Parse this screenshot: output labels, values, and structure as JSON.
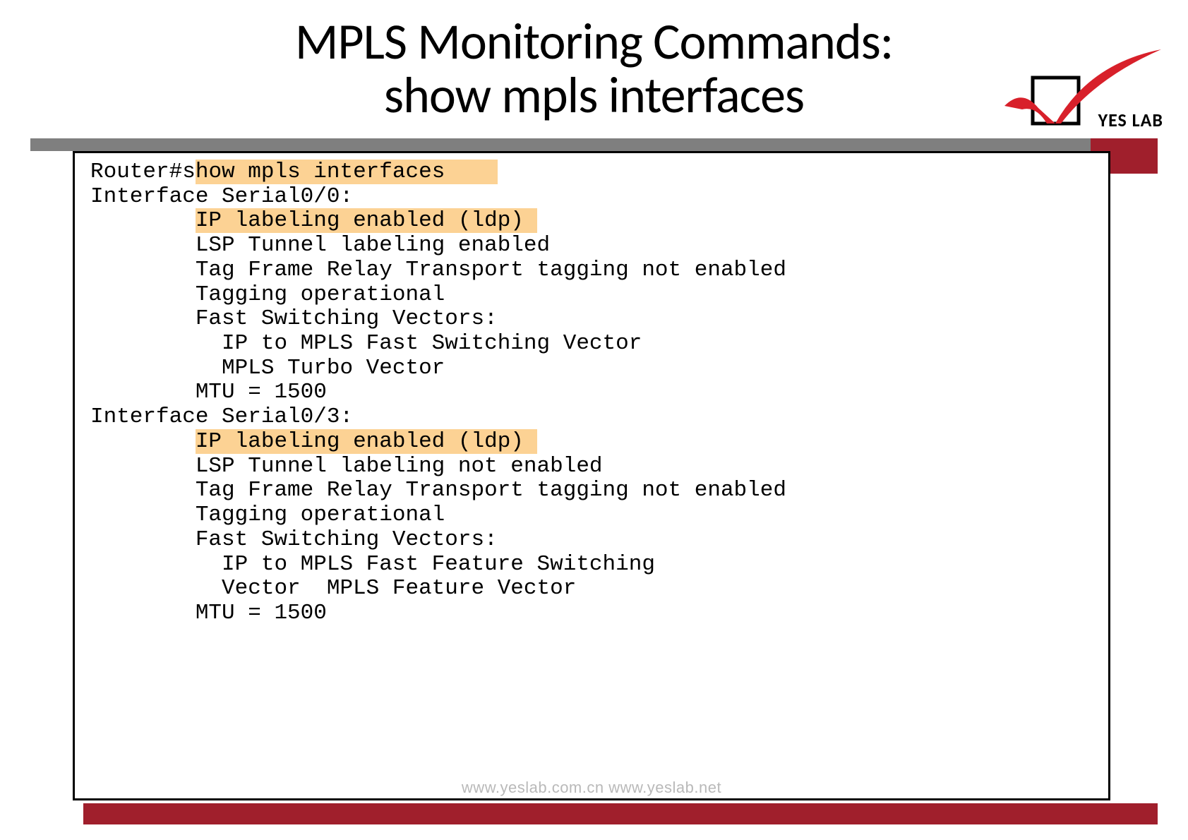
{
  "title_line1": "MPLS Monitoring Commands:",
  "title_line2": "show mpls interfaces",
  "logo_text": "YES LAB",
  "terminal": {
    "prompt_prefix": "Router#",
    "command_pre": "s",
    "command_hl": "how mpls interfaces",
    "if0": {
      "header": "Interface Serial0/0:",
      "ip_label_hl": "IP labeling enabled (ldp)",
      "lsp": "LSP Tunnel labeling enabled",
      "frr": "Tag Frame Relay Transport tagging not enabled",
      "tag": "Tagging operational",
      "fsv": "Fast Switching Vectors:",
      "fsv1": "IP to MPLS Fast Switching Vector",
      "fsv2": "MPLS Turbo Vector",
      "mtu": "MTU = 1500"
    },
    "if1": {
      "header": "Interface Serial0/3:",
      "ip_label_hl": "IP labeling enabled (ldp)",
      "lsp": "LSP Tunnel labeling not enabled",
      "frr": "Tag Frame Relay Transport tagging not enabled",
      "tag": "Tagging operational",
      "fsv": "Fast Switching Vectors:",
      "fsv1": "IP to MPLS Fast Feature Switching",
      "fsv2": "Vector  MPLS Feature Vector",
      "mtu": "MTU = 1500"
    }
  },
  "watermark": "www.yeslab.com.cn   www.yeslab.net"
}
